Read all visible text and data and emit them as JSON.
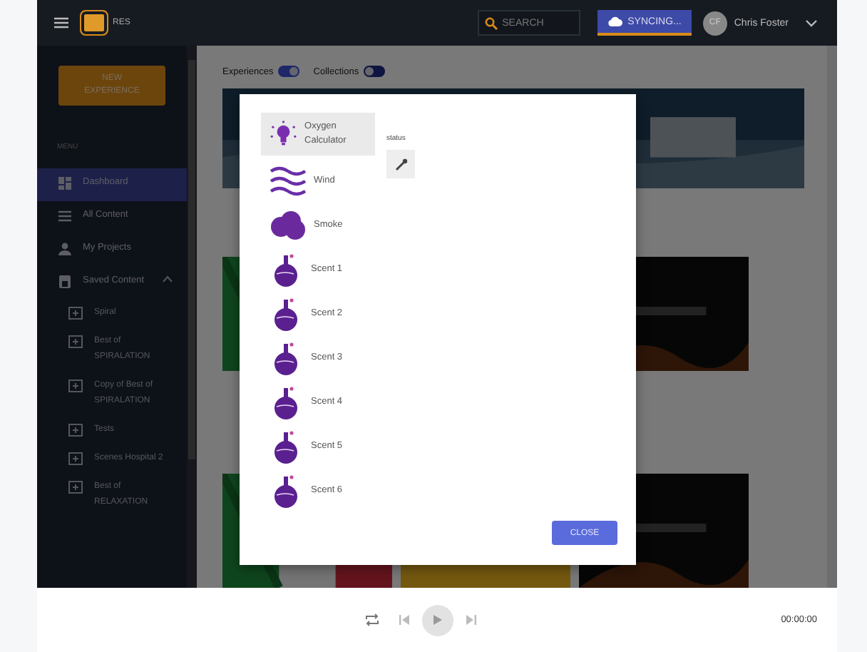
{
  "app": {
    "logo_text": "RES"
  },
  "search": {
    "placeholder": "SEARCH"
  },
  "sync_button": "SYNCING...",
  "user": {
    "initials": "CF",
    "name": "Chris Foster"
  },
  "sidebar": {
    "new_button": "NEW EXPERIENCE",
    "section_label": "MENU",
    "items": [
      {
        "label": "Dashboard",
        "kind": "dashboard",
        "selected": true
      },
      {
        "label": "All Content",
        "kind": "list",
        "selected": false
      },
      {
        "label": "My Projects",
        "kind": "person",
        "selected": false
      },
      {
        "label": "Saved Content",
        "kind": "saved",
        "selected": false,
        "expanded": true,
        "children": [
          {
            "label": "Spiral",
            "selected": false
          },
          {
            "label": "Best of SPIRALATION",
            "selected": false
          },
          {
            "label": "Copy of Best of SPIRALATION",
            "selected": false
          },
          {
            "label": "Tests",
            "selected": false
          },
          {
            "label": "Scenes Hospital 2",
            "selected": false
          },
          {
            "label": "Best of RELAXATION",
            "selected": false
          }
        ]
      }
    ]
  },
  "filters": [
    {
      "label": "Experiences",
      "on": true
    },
    {
      "label": "Collections",
      "on": false
    }
  ],
  "modal": {
    "items": [
      {
        "label": "Oxygen Calculator",
        "kind": "bulb",
        "selected": true
      },
      {
        "label": "Wind",
        "kind": "waves",
        "selected": false
      },
      {
        "label": "Smoke",
        "kind": "cloud",
        "selected": false
      },
      {
        "label": "Scent 1",
        "kind": "flask",
        "selected": false
      },
      {
        "label": "Scent 2",
        "kind": "flask",
        "selected": false
      },
      {
        "label": "Scent 3",
        "kind": "flask",
        "selected": false
      },
      {
        "label": "Scent 4",
        "kind": "flask",
        "selected": false
      },
      {
        "label": "Scent 5",
        "kind": "flask",
        "selected": false
      },
      {
        "label": "Scent 6",
        "kind": "flask",
        "selected": false
      }
    ],
    "field_label": "status",
    "close_button": "CLOSE"
  },
  "player": {
    "time": "00:00:00"
  }
}
